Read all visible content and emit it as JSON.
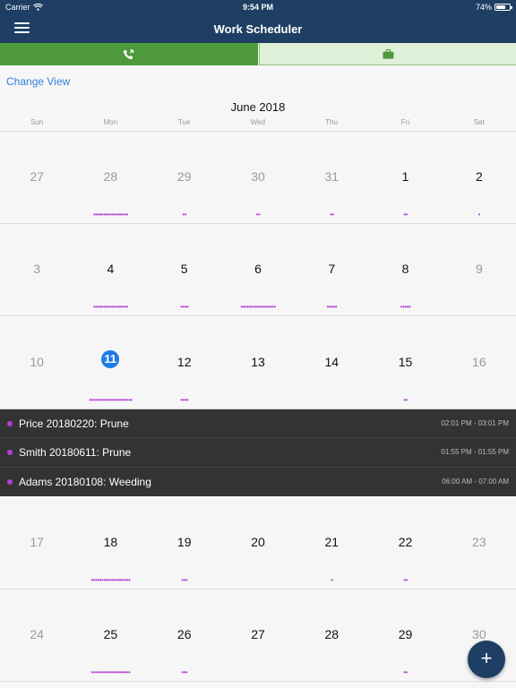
{
  "status_bar": {
    "carrier": "Carrier",
    "time": "9:54 PM",
    "battery": "74%"
  },
  "navbar": {
    "title": "Work Scheduler",
    "menu_icon": "hamburger-menu-icon"
  },
  "segments": [
    {
      "icon": "phone-icon",
      "selected": true,
      "color": "#4e9a3c"
    },
    {
      "icon": "briefcase-icon",
      "selected": false,
      "color": "#dff0d8"
    }
  ],
  "change_view_label": "Change View",
  "calendar": {
    "month": "June 2018",
    "weekdays": [
      "Sun",
      "Mon",
      "Tue",
      "Wed",
      "Thu",
      "Fri",
      "Sat"
    ],
    "weeks": [
      {
        "days": [
          {
            "num": "27",
            "muted": true,
            "dots": ""
          },
          {
            "num": "28",
            "muted": true,
            "dots": "•••••••••••••••••"
          },
          {
            "num": "29",
            "muted": true,
            "dots": "••"
          },
          {
            "num": "30",
            "muted": true,
            "dots": "••"
          },
          {
            "num": "31",
            "muted": true,
            "dots": "••"
          },
          {
            "num": "1",
            "muted": false,
            "dots": "••"
          },
          {
            "num": "2",
            "muted": false,
            "dots": "•"
          }
        ]
      },
      {
        "days": [
          {
            "num": "3",
            "muted": true,
            "dots": ""
          },
          {
            "num": "4",
            "muted": false,
            "dots": "•••••••••••••••••"
          },
          {
            "num": "5",
            "muted": false,
            "dots": "••••"
          },
          {
            "num": "6",
            "muted": false,
            "dots": "•••••••••••••••••"
          },
          {
            "num": "7",
            "muted": false,
            "dots": "•••••"
          },
          {
            "num": "8",
            "muted": false,
            "dots": "•••••"
          },
          {
            "num": "9",
            "muted": true,
            "dots": ""
          }
        ]
      },
      {
        "days": [
          {
            "num": "10",
            "muted": true,
            "dots": ""
          },
          {
            "num": "11",
            "muted": false,
            "today": true,
            "dots": "•••••••••••••••••••••"
          },
          {
            "num": "12",
            "muted": false,
            "dots": "••••"
          },
          {
            "num": "13",
            "muted": false,
            "dots": ""
          },
          {
            "num": "14",
            "muted": false,
            "dots": ""
          },
          {
            "num": "15",
            "muted": false,
            "dots": "••"
          },
          {
            "num": "16",
            "muted": true,
            "dots": ""
          }
        ]
      },
      {
        "days": [
          {
            "num": "17",
            "muted": true,
            "dots": ""
          },
          {
            "num": "18",
            "muted": false,
            "dots": "•••••••••••••••••••"
          },
          {
            "num": "19",
            "muted": false,
            "dots": "•••"
          },
          {
            "num": "20",
            "muted": false,
            "dots": ""
          },
          {
            "num": "21",
            "muted": false,
            "dots": "•"
          },
          {
            "num": "22",
            "muted": false,
            "dots": "••"
          },
          {
            "num": "23",
            "muted": true,
            "dots": ""
          }
        ]
      },
      {
        "days": [
          {
            "num": "24",
            "muted": true,
            "dots": ""
          },
          {
            "num": "25",
            "muted": false,
            "dots": "•••••••••••••••••••"
          },
          {
            "num": "26",
            "muted": false,
            "dots": "•••"
          },
          {
            "num": "27",
            "muted": false,
            "dots": ""
          },
          {
            "num": "28",
            "muted": false,
            "dots": ""
          },
          {
            "num": "29",
            "muted": false,
            "dots": "••"
          },
          {
            "num": "30",
            "muted": true,
            "dots": ""
          }
        ]
      }
    ]
  },
  "events": [
    {
      "title": "Price 20180220: Prune",
      "time": "02:01 PM - 03:01 PM"
    },
    {
      "title": "Smith 20180611: Prune",
      "time": "01:55 PM - 01:55 PM"
    },
    {
      "title": "Adams 20180108: Weeding",
      "time": "06:00 AM - 07:00 AM"
    }
  ],
  "fab_label": "+",
  "colors": {
    "navbar": "#1e3f63",
    "accent_blue": "#1f7be6",
    "dot": "#b43fd6",
    "event_bg": "#333333"
  }
}
